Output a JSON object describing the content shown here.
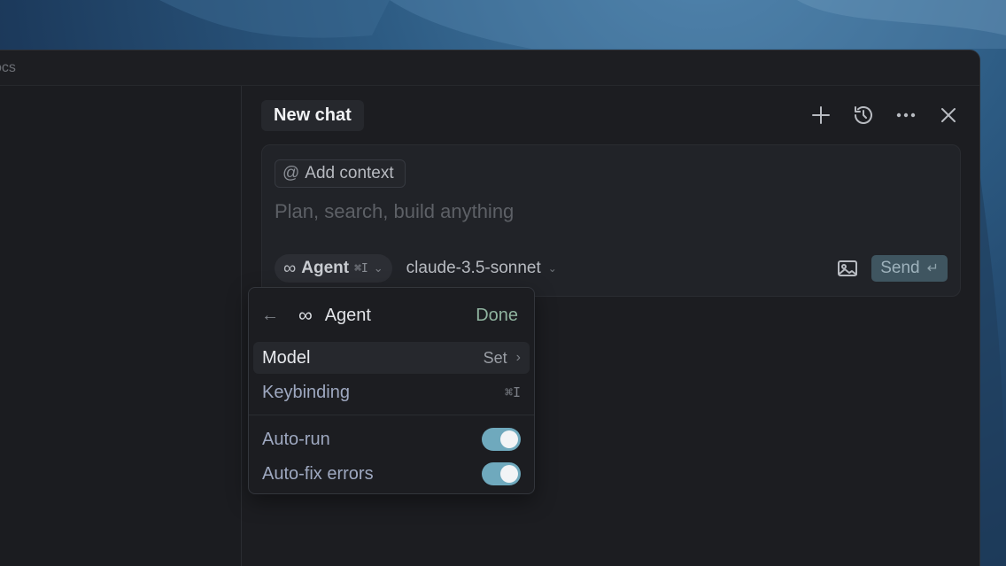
{
  "window": {
    "title": "ocs"
  },
  "chat": {
    "tab_title": "New chat",
    "header_actions": [
      "plus-icon",
      "history-icon",
      "more-icon",
      "close-icon"
    ]
  },
  "composer": {
    "add_context_label": "Add context",
    "placeholder": "Plan, search, build anything",
    "mode_label": "Agent",
    "mode_shortcut": "⌘I",
    "model_label": "claude-3.5-sonnet",
    "send_label": "Send"
  },
  "agent_menu": {
    "title": "Agent",
    "done_label": "Done",
    "items": [
      {
        "label": "Model",
        "value": "Set"
      },
      {
        "label": "Keybinding",
        "value": "⌘I"
      }
    ],
    "toggles": [
      {
        "label": "Auto-run",
        "on": true
      },
      {
        "label": "Auto-fix errors",
        "on": true
      }
    ]
  },
  "colors": {
    "accent_toggle": "#6fa9bd",
    "done": "#8fb39f",
    "send_bg": "#3f5560"
  }
}
